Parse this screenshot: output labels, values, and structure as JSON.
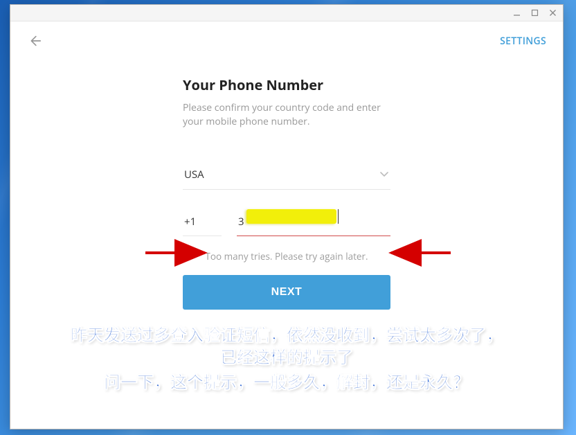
{
  "window_controls": {
    "minimize": "–",
    "maximize": "□",
    "close": "×"
  },
  "topbar": {
    "settings": "SETTINGS"
  },
  "form": {
    "heading": "Your Phone Number",
    "sub": "Please confirm your country code and enter your mobile phone number.",
    "country": "USA",
    "code": "+1",
    "number_visible_prefix": "3",
    "error": "Too many tries. Please try again later.",
    "next": "NEXT"
  },
  "overlay": {
    "line1": "昨天发送过多登入验证短信，依然没收到，尝试太多次了，",
    "line2": "已经这样的提示了",
    "line3": "问一下，这个提示，一般多久，解封，还是永久？"
  }
}
